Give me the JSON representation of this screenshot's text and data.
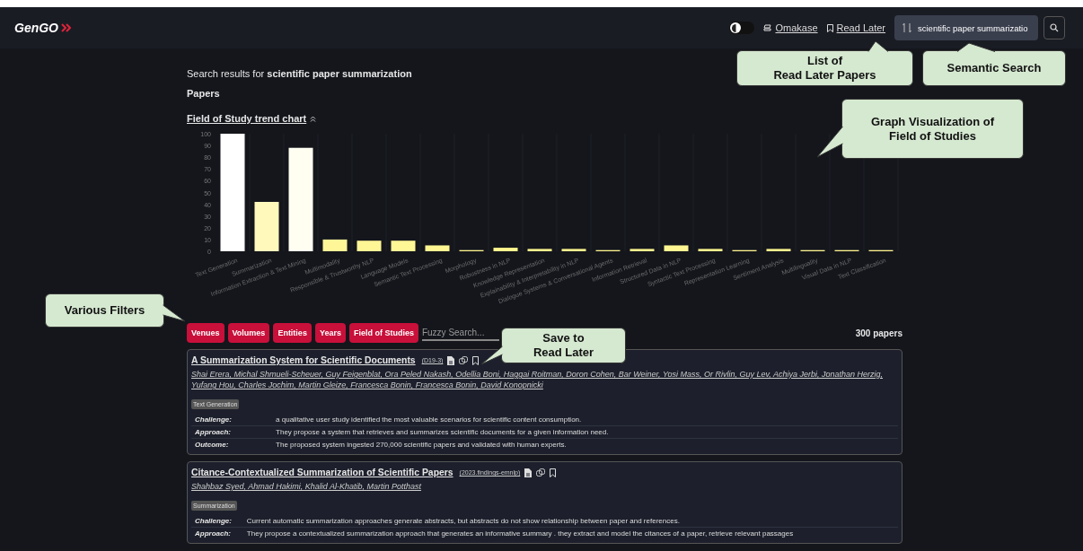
{
  "header": {
    "logo": "GenGO",
    "theme_toggle": {
      "on": false
    },
    "links": [
      {
        "kind": "omakase",
        "label": "Omakase"
      },
      {
        "kind": "read_later",
        "label": "Read Later"
      }
    ],
    "search": {
      "value": "scientific paper summarizatio"
    }
  },
  "results": {
    "prefix": "Search results for ",
    "query": "scientific paper summarization",
    "section": "Papers"
  },
  "chart": {
    "title": "Field of Study trend chart",
    "chart_data": {
      "type": "bar",
      "categories": [
        "Text Generation",
        "Summarization",
        "Information Extraction & Text Mining",
        "Multimodality",
        "Responsible & Trustworthy NLP",
        "Language Models",
        "Semantic Text Processing",
        "Morphology",
        "Robustness in NLP",
        "Knowledge Representation",
        "Explainability & Interpretability in NLP",
        "Dialogue Systems & Conversational Agents",
        "Information Retrieval",
        "Structured Data in NLP",
        "Syntactic Text Processing",
        "Representation Learning",
        "Sentiment Analysis",
        "Multilinguality",
        "Visual Data in NLP",
        "Text Classification"
      ],
      "values": [
        100,
        42,
        88,
        10,
        9,
        9,
        5,
        1,
        3,
        2,
        2,
        1,
        2,
        5,
        2,
        1,
        2,
        1,
        1,
        1
      ],
      "ylim": [
        0,
        100
      ],
      "yticks": [
        0,
        10,
        20,
        30,
        40,
        50,
        60,
        70,
        80,
        90,
        100
      ]
    }
  },
  "filters": {
    "buttons": [
      "Venues",
      "Volumes",
      "Entities",
      "Years",
      "Field of Studies"
    ],
    "search_placeholder": "Fuzzy Search...",
    "count": "300 papers"
  },
  "papers": [
    {
      "title": "A Summarization System for Scientific Documents",
      "venue": "(D19-3)",
      "authors": "Shai Erera, Michal Shmueli-Scheuer, Guy Feigenblat, Ora Peled Nakash, Odellia Boni, Haggai Roitman, Doron Cohen, Bar Weiner, Yosi Mass, Or Rivlin, Guy Lev, Achiya Jerbi, Jonathan Herzig, Yufang Hou, Charles Jochim, Martin Gleize, Francesca Bonin, Francesca Bonin, David Konopnicki",
      "tag": "Text Generation",
      "rows": [
        {
          "label": "Challenge:",
          "text": "a qualitative user study identified the most valuable scenarios for scientific content consumption."
        },
        {
          "label": "Approach:",
          "text": "They propose a system that retrieves and summarizes scientific documents for a given information need."
        },
        {
          "label": "Outcome:",
          "text": "The proposed system ingested 270,000 scientific papers and validated with human experts."
        }
      ]
    },
    {
      "title": "Citance-Contextualized Summarization of Scientific Papers",
      "venue": "(2023.findings-emnlp)",
      "authors": "Shahbaz Syed, Ahmad Hakimi, Khalid Al-Khatib, Martin Potthast",
      "tag": "Summarization",
      "rows": [
        {
          "label": "Challenge:",
          "text": "Current automatic summarization approaches generate abstracts, but abstracts do not show relationship between paper and references."
        },
        {
          "label": "Approach:",
          "text": "They propose a contextualized summarization approach that generates an informative summary . they extract and model the citances of a paper, retrieve relevant passages"
        }
      ]
    }
  ],
  "callouts": [
    {
      "kind": "up",
      "text": "List of\nRead Later Papers"
    },
    {
      "kind": "up",
      "text": "Semantic Search"
    },
    {
      "kind": "left",
      "text": "Graph Visualization of\nField of Studies"
    },
    {
      "kind": "right",
      "text": "Various Filters"
    },
    {
      "kind": "left",
      "text": "Save to\nRead Later"
    }
  ]
}
